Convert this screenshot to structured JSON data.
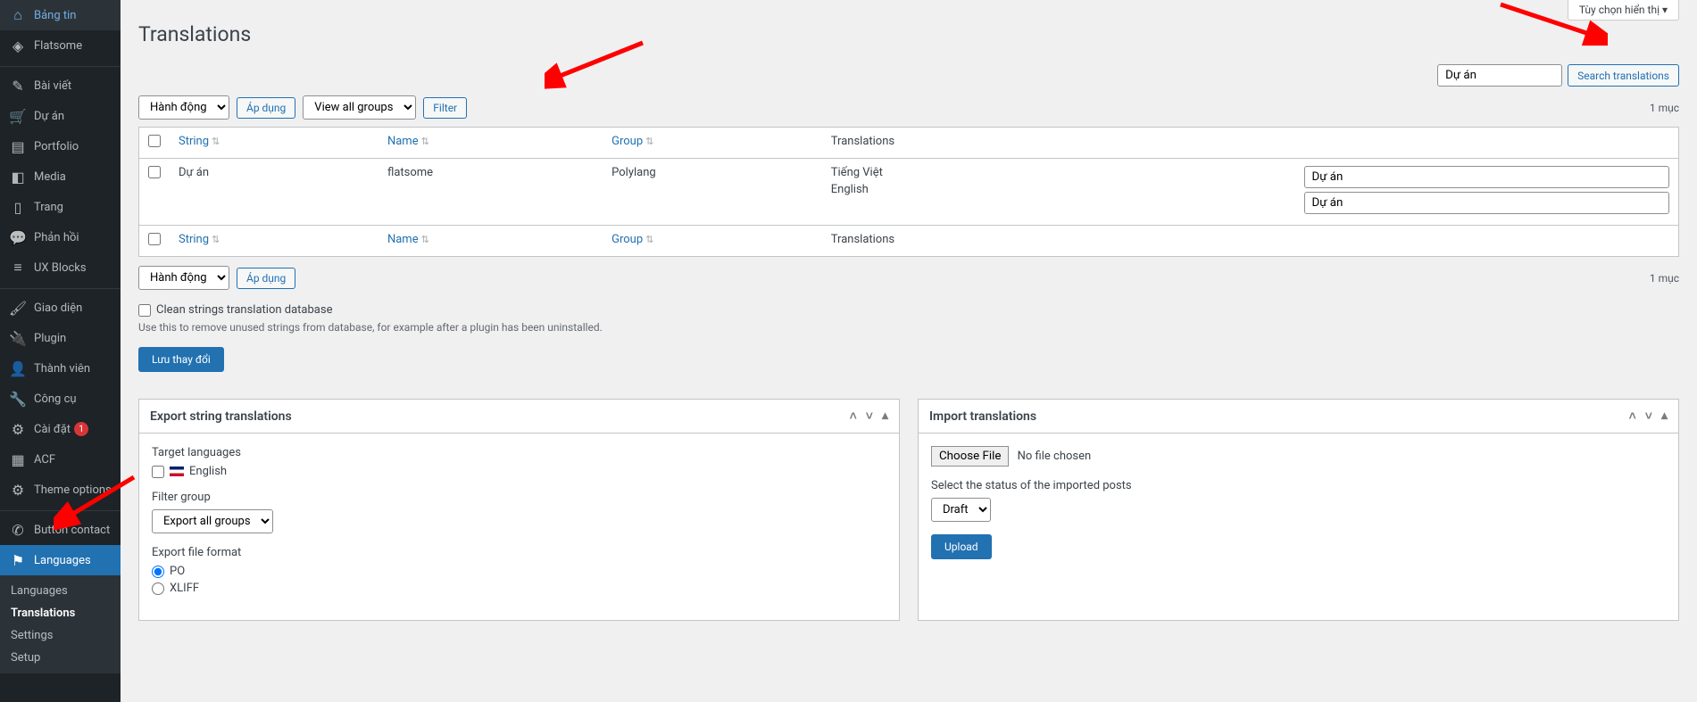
{
  "screen_options": "Tùy chọn hiển thị",
  "page_title": "Translations",
  "sidebar": {
    "items": [
      {
        "icon": "dashboard",
        "label": "Bảng tin"
      },
      {
        "icon": "flatsome",
        "label": "Flatsome"
      },
      {
        "icon": "pin",
        "label": "Bài viết"
      },
      {
        "icon": "cart",
        "label": "Dự án"
      },
      {
        "icon": "portfolio",
        "label": "Portfolio"
      },
      {
        "icon": "media",
        "label": "Media"
      },
      {
        "icon": "pages",
        "label": "Trang"
      },
      {
        "icon": "comments",
        "label": "Phản hồi"
      },
      {
        "icon": "ux",
        "label": "UX Blocks"
      },
      {
        "icon": "appearance",
        "label": "Giao diện"
      },
      {
        "icon": "plugins",
        "label": "Plugin"
      },
      {
        "icon": "users",
        "label": "Thành viên"
      },
      {
        "icon": "tools",
        "label": "Công cụ"
      },
      {
        "icon": "settings",
        "label": "Cài đặt",
        "badge": "1"
      },
      {
        "icon": "acf",
        "label": "ACF"
      },
      {
        "icon": "theme",
        "label": "Theme options"
      },
      {
        "icon": "phone",
        "label": "Button contact"
      },
      {
        "icon": "lang",
        "label": "Languages",
        "active": true
      }
    ],
    "submenu": [
      {
        "label": "Languages"
      },
      {
        "label": "Translations",
        "current": true
      },
      {
        "label": "Settings"
      },
      {
        "label": "Setup"
      }
    ]
  },
  "search": {
    "value": "Dự án",
    "button": "Search translations"
  },
  "bulk": {
    "action": "Hành động",
    "apply": "Áp dụng"
  },
  "filter": {
    "groups": "View all groups",
    "button": "Filter"
  },
  "items_count": "1 mục",
  "columns": {
    "string": "String",
    "name": "Name",
    "group": "Group",
    "translations": "Translations"
  },
  "row": {
    "string": "Dự án",
    "name": "flatsome",
    "group": "Polylang",
    "langs": [
      {
        "label": "Tiếng Việt",
        "value": "Dự án"
      },
      {
        "label": "English",
        "value": "Dự án"
      }
    ]
  },
  "clean": {
    "checkbox": "Clean strings translation database",
    "desc": "Use this to remove unused strings from database, for example after a plugin has been uninstalled."
  },
  "save_button": "Lưu thay đổi",
  "export": {
    "title": "Export string translations",
    "target_label": "Target languages",
    "english": "English",
    "filter_group_label": "Filter group",
    "filter_group_value": "Export all groups",
    "format_label": "Export file format",
    "po": "PO",
    "xliff": "XLIFF"
  },
  "import": {
    "title": "Import translations",
    "choose": "Choose File",
    "nofile": "No file chosen",
    "status_label": "Select the status of the imported posts",
    "status_value": "Draft",
    "upload": "Upload"
  }
}
